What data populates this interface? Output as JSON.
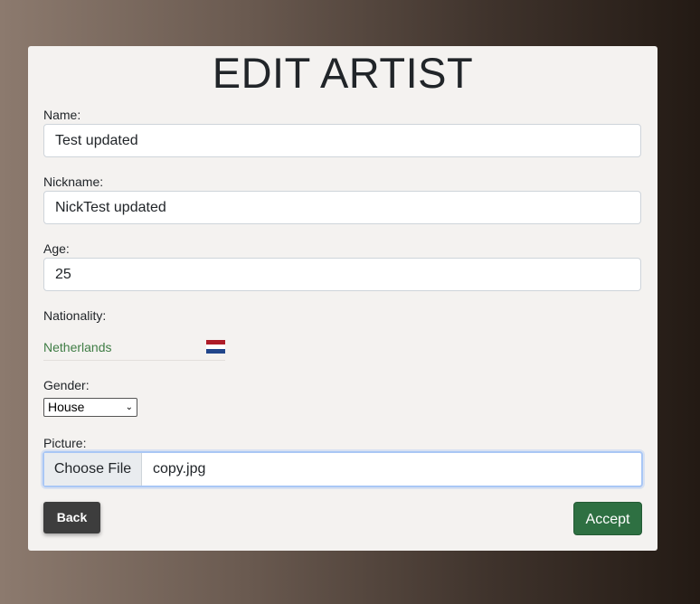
{
  "form": {
    "title": "EDIT ARTIST",
    "name": {
      "label": "Name:",
      "value": "Test updated"
    },
    "nickname": {
      "label": "Nickname:",
      "value": "NickTest updated"
    },
    "age": {
      "label": "Age:",
      "value": "25"
    },
    "nationality": {
      "label": "Nationality:",
      "value": "Netherlands",
      "flag_icon": "netherlands-flag-icon",
      "flag_colors": [
        "#ae1c28",
        "#ffffff",
        "#21468b"
      ]
    },
    "gender": {
      "label": "Gender:",
      "selected": "House"
    },
    "picture": {
      "label": "Picture:",
      "button_label": "Choose File",
      "file_name": "copy.jpg"
    }
  },
  "actions": {
    "back_label": "Back",
    "accept_label": "Accept"
  },
  "colors": {
    "accept": "#2e7042",
    "back": "#3d3d3d",
    "nationality_text": "#3f7d45"
  }
}
